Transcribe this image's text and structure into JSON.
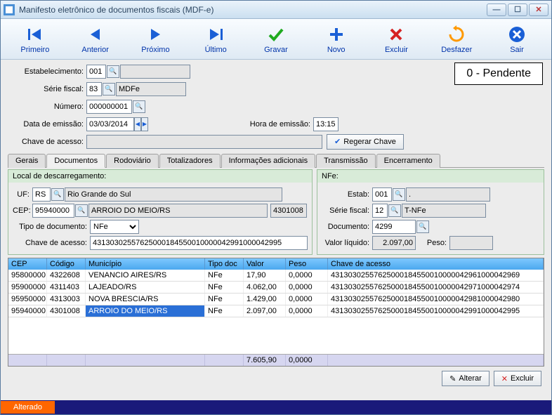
{
  "window": {
    "title": "Manifesto eletrônico de documentos fiscais (MDF-e)"
  },
  "toolbar": {
    "primeiro": "Primeiro",
    "anterior": "Anterior",
    "proximo": "Próximo",
    "ultimo": "Último",
    "gravar": "Gravar",
    "novo": "Novo",
    "excluir": "Excluir",
    "desfazer": "Desfazer",
    "sair": "Sair"
  },
  "status_box": "0 - Pendente",
  "labels": {
    "estabelecimento": "Estabelecimento:",
    "serie_fiscal": "Série fiscal:",
    "numero": "Número:",
    "data_emissao": "Data de emissão:",
    "hora_emissao": "Hora de emissão:",
    "chave_acesso": "Chave de acesso:",
    "regerar": "Regerar Chave",
    "uf": "UF:",
    "cep": "CEP:",
    "tipo_doc": "Tipo de documento:",
    "chave_acesso2": "Chave de acesso:",
    "nfe_estab": "Estab:",
    "nfe_serie": "Série fiscal:",
    "nfe_doc": "Documento:",
    "nfe_valor": "Valor líquido:",
    "nfe_peso": "Peso:"
  },
  "fields": {
    "estab": "001",
    "serie": "83",
    "serie_desc": "MDFe",
    "numero": "000000001",
    "data": "03/03/2014",
    "hora": "13:15",
    "chave": "",
    "uf": "RS",
    "uf_desc": "Rio Grande do Sul",
    "cep": "95940000",
    "cep_desc": "ARROIO DO MEIO/RS",
    "cep_cod": "4301008",
    "tipo_doc": "NFe",
    "chave2": "43130302557625000184550010000042991000042995",
    "nfe_estab": "001",
    "nfe_estab_desc": ".",
    "nfe_serie": "12",
    "nfe_serie_desc": "T-NFe",
    "nfe_doc": "4299",
    "nfe_valor": "2.097,00",
    "nfe_peso": ""
  },
  "tabs": [
    "Gerais",
    "Documentos",
    "Rodoviário",
    "Totalizadores",
    "Informações adicionais",
    "Transmissão",
    "Encerramento"
  ],
  "active_tab": 1,
  "groups": {
    "local": "Local de descarregamento:",
    "nfe": "NFe:"
  },
  "grid": {
    "headers": [
      "CEP",
      "Código",
      "Município",
      "Tipo doc",
      "Valor",
      "Peso",
      "Chave de acesso"
    ],
    "rows": [
      {
        "cep": "95800000",
        "cod": "4322608",
        "mun": "VENANCIO AIRES/RS",
        "tip": "NFe",
        "val": "17,90",
        "pes": "0,0000",
        "cha": "43130302557625000184550010000042961000042969"
      },
      {
        "cep": "95900000",
        "cod": "4311403",
        "mun": "LAJEADO/RS",
        "tip": "NFe",
        "val": "4.062,00",
        "pes": "0,0000",
        "cha": "43130302557625000184550010000042971000042974"
      },
      {
        "cep": "95950000",
        "cod": "4313003",
        "mun": "NOVA BRESCIA/RS",
        "tip": "NFe",
        "val": "1.429,00",
        "pes": "0,0000",
        "cha": "43130302557625000184550010000042981000042980"
      },
      {
        "cep": "95940000",
        "cod": "4301008",
        "mun": "ARROIO DO MEIO/RS",
        "tip": "NFe",
        "val": "2.097,00",
        "pes": "0,0000",
        "cha": "43130302557625000184550010000042991000042995",
        "sel": true
      }
    ],
    "footer": {
      "val": "7.605,90",
      "pes": "0,0000"
    }
  },
  "buttons": {
    "alterar": "Alterar",
    "excluir": "Excluir"
  },
  "statusbar": {
    "alterado": "Alterado"
  }
}
